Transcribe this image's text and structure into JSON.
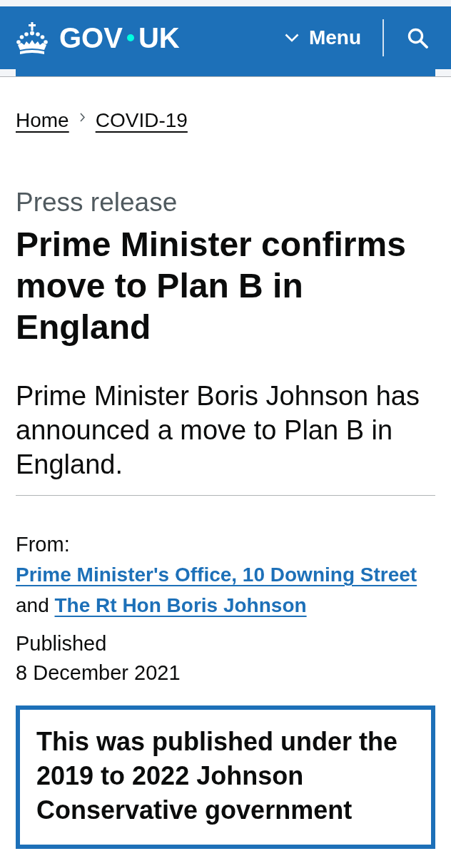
{
  "header": {
    "logo": {
      "left": "GOV",
      "right": "UK"
    },
    "menu_button": {
      "label": "Menu",
      "expanded": false
    }
  },
  "breadcrumbs": [
    {
      "label": "Home"
    },
    {
      "label": "COVID-19"
    }
  ],
  "document_type": "Press release",
  "title": "Prime Minister confirms move to Plan B in England",
  "lead": "Prime Minister Boris Johnson has announced a move to Plan B in England.",
  "metadata": {
    "from_label": "From:",
    "from": [
      {
        "kind": "link",
        "text": "Prime Minister's Office, 10 Downing Street"
      },
      {
        "kind": "text",
        "text": "and"
      },
      {
        "kind": "link",
        "text": "The Rt Hon Boris Johnson"
      }
    ],
    "published_label": "Published",
    "published_date": "8 December 2021"
  },
  "history_notice": "This was published under the 2019 to 2022 Johnson Conservative government"
}
